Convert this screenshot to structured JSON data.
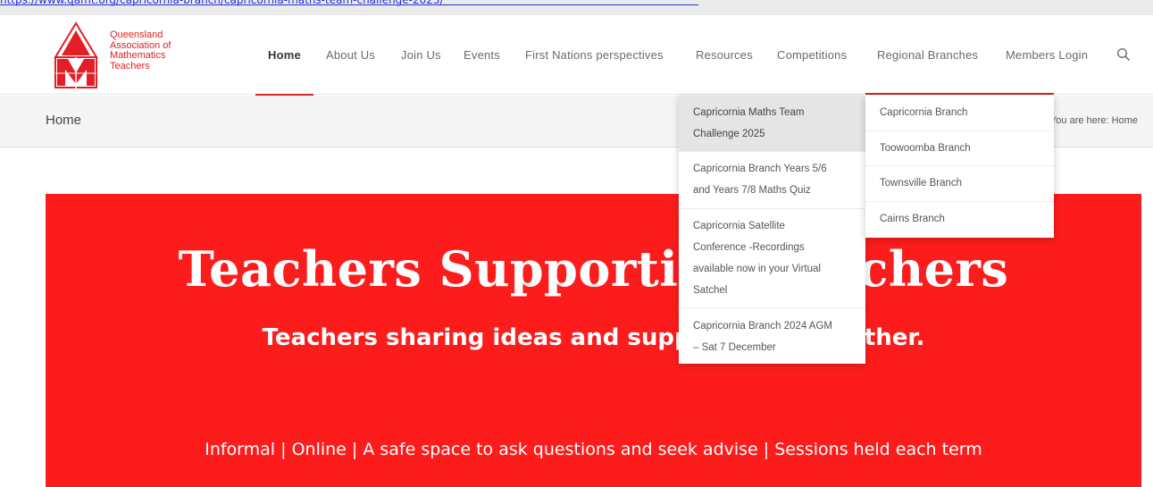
{
  "browser": {
    "top_link": "https://www.qamt.org/capricornia-branch/capricornia-maths-team-challenge-2025/"
  },
  "site": {
    "logo_text": [
      "Queensland",
      "Association of",
      "Mathematics",
      "Teachers"
    ],
    "brand_color": "#e31e24"
  },
  "nav": {
    "items": [
      {
        "label": "Home",
        "active": true
      },
      {
        "label": "About Us"
      },
      {
        "label": "Join Us"
      },
      {
        "label": "Events"
      },
      {
        "label": "First Nations perspectives"
      },
      {
        "label": "Resources"
      },
      {
        "label": "Competitions"
      },
      {
        "label": "Regional Branches"
      },
      {
        "label": "Members Login"
      }
    ],
    "search_icon": "search-icon"
  },
  "titlebar": {
    "title": "Home",
    "breadcrumb": "You are here:  Home"
  },
  "dropdowns": {
    "capricornia": [
      [
        "Capricornia Maths Team",
        "Challenge 2025"
      ],
      [
        "Capricornia Branch Years 5/6",
        "and Years 7/8 Maths Quiz"
      ],
      [
        "Capricornia Satellite",
        "Conference -Recordings",
        "available now in your Virtual",
        "Satchel"
      ],
      [
        "Capricornia Branch 2024 AGM",
        "– Sat 7 December"
      ]
    ],
    "regional": [
      "Capricornia Branch",
      "Toowoomba Branch",
      "Townsville Branch",
      "Cairns Branch"
    ]
  },
  "hero": {
    "title": "Teachers Supporting Teachers",
    "subtitle": "Teachers sharing ideas and supporting each other.",
    "info": "Informal | Online | A safe space to ask questions and seek advise | Sessions held each term",
    "background": "#fd1c1c"
  }
}
